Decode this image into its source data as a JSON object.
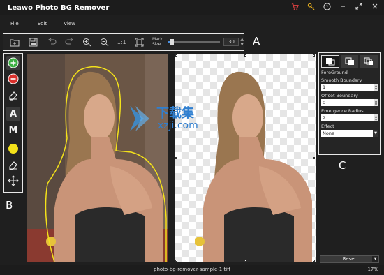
{
  "app": {
    "title": "Leawo Photo BG Remover"
  },
  "window_icons": [
    "cart-icon",
    "key-icon",
    "help-icon",
    "minimize-icon",
    "maximize-icon",
    "close-icon"
  ],
  "menu": {
    "items": [
      "File",
      "Edit",
      "View"
    ]
  },
  "toolbar": {
    "ratio_label": "1:1",
    "mark_label_line1": "Mark",
    "mark_label_line2": "Size",
    "mark_size_value": "30",
    "mark_size_fraction": 0.08
  },
  "callouts": {
    "a": "A",
    "b": "B",
    "c": "C"
  },
  "left_tools": {
    "auto_label": "A",
    "manual_label": "M"
  },
  "right_panel": {
    "foreground_label": "ForeGround",
    "smooth_boundary_label": "Smooth Boundary",
    "smooth_boundary_value": "1",
    "offset_boundary_label": "Offset Boundary",
    "offset_boundary_value": "0",
    "emergence_radius_label": "Emergence Radius",
    "emergence_radius_value": "2",
    "effect_label": "Effect",
    "effect_value": "None"
  },
  "reset_label": "Reset",
  "status": {
    "filename": "photo-bg-remover-sample-1.tiff",
    "zoom": "17%"
  },
  "watermark": {
    "cn_text": "下载集",
    "url_text": "xzji.com"
  },
  "colors": {
    "accent": "#4a90e2",
    "highlight_yellow": "#f4e21a",
    "add_green": "#3cb043",
    "remove_red": "#d9302c"
  }
}
